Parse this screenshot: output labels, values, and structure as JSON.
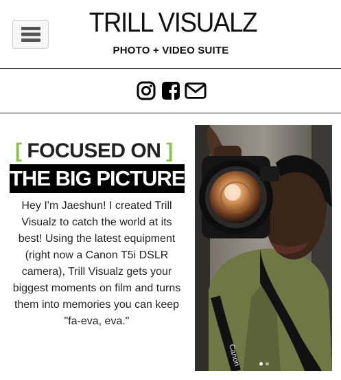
{
  "header": {
    "brand": "TRILL VISUALZ",
    "tagline": "PHOTO + VIDEO SUITE"
  },
  "social": {
    "icons": [
      "instagram-icon",
      "facebook-icon",
      "envelope-icon"
    ]
  },
  "hero": {
    "heading_open": "[",
    "heading_line1": "FOCUSED ON",
    "heading_close": "]",
    "heading_line2": "THE BIG PICTURE",
    "bio": "Hey I'm Jaeshun! I created Trill Visualz to catch the world at its best! Using the latest equipment (right now a Canon T5i DSLR camera), Trill Visualz gets your biggest moments on film and turns them into memories you can keep \"fa-eva, eva.\"",
    "accent_color": "#8bc34a"
  },
  "carousel": {
    "slide_count": 2,
    "active_slide": 1,
    "strap_text": "Canon"
  }
}
